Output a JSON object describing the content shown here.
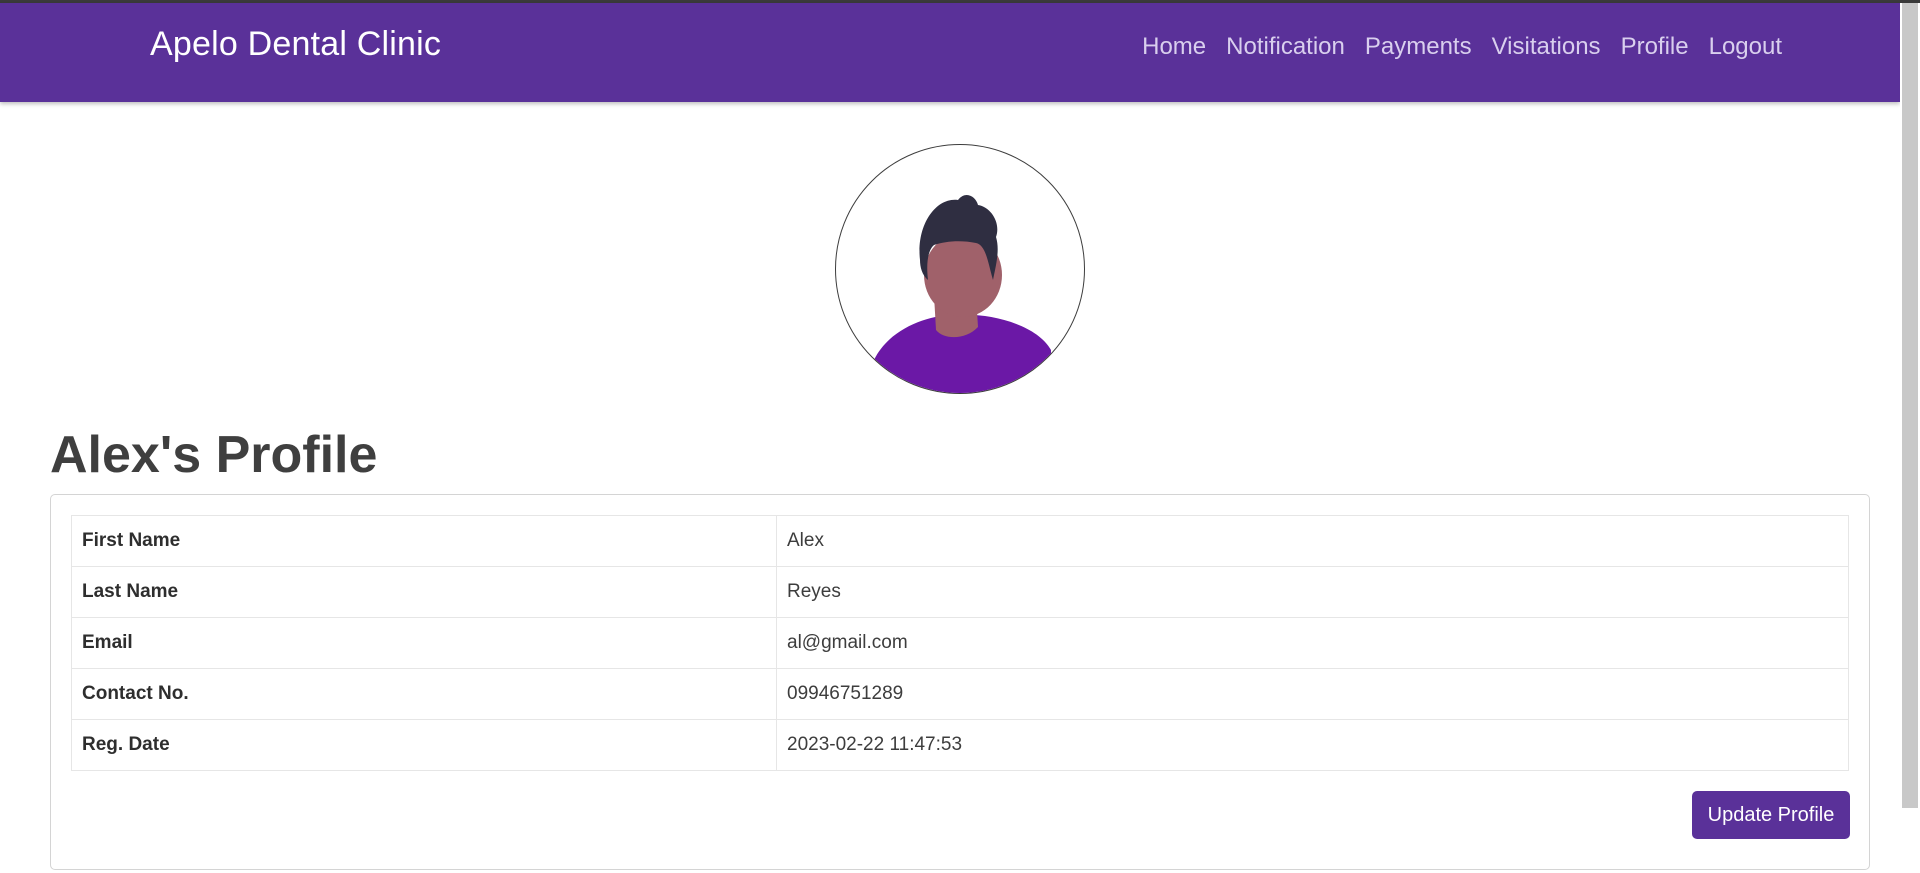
{
  "brand": "Apelo Dental Clinic",
  "nav": [
    "Home",
    "Notification",
    "Payments",
    "Visitations",
    "Profile",
    "Logout"
  ],
  "avatar_icon": "user-avatar-illustration",
  "profile_title": "Alex's Profile",
  "profile_rows": [
    {
      "label": "First Name",
      "value": "Alex"
    },
    {
      "label": "Last Name",
      "value": "Reyes"
    },
    {
      "label": "Email",
      "value": "al@gmail.com"
    },
    {
      "label": "Contact No.",
      "value": "09946751289"
    },
    {
      "label": "Reg. Date",
      "value": "2023-02-22 11:47:53"
    }
  ],
  "update_button": "Update Profile",
  "colors": {
    "primary": "#5a3199",
    "shirt": "#6b18a6",
    "skin": "#a0616a",
    "hair": "#2f2e41"
  }
}
